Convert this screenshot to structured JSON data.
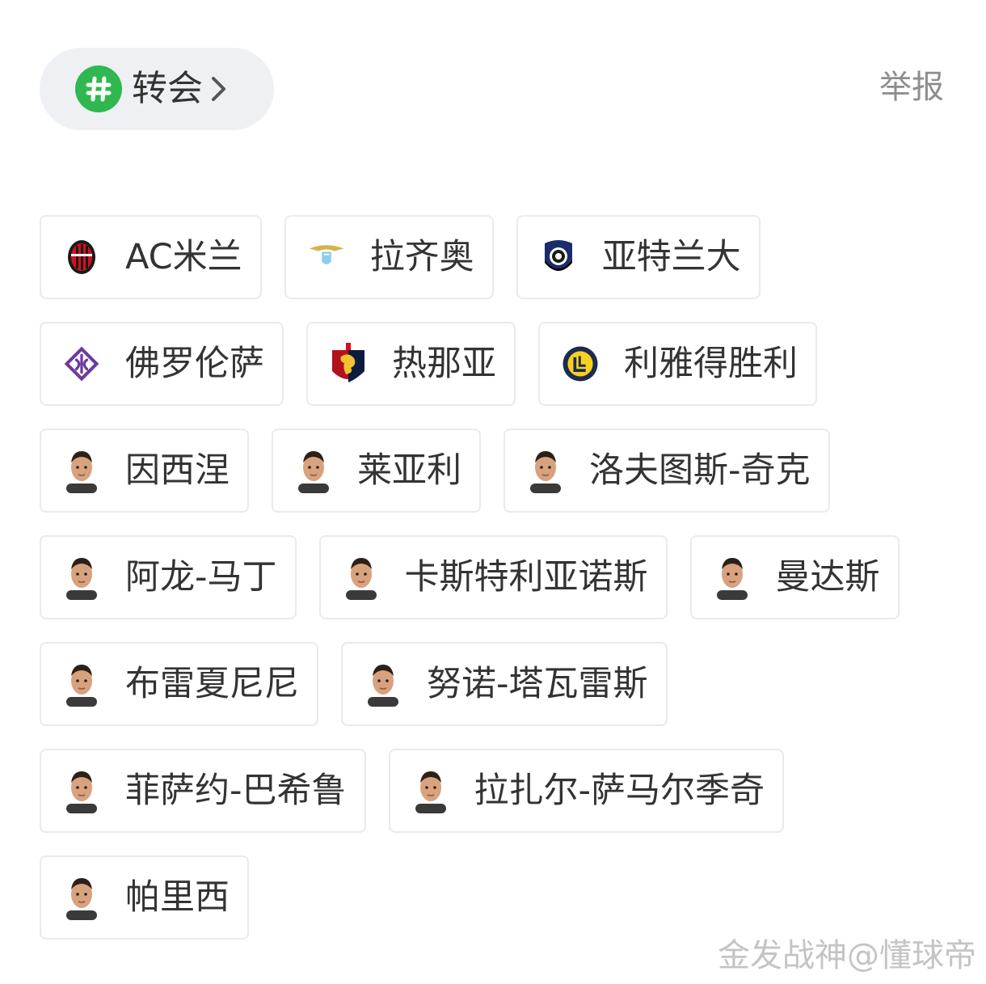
{
  "topic": {
    "label": "转会",
    "icon": "hashtag-icon",
    "accent_color": "#2fb84f"
  },
  "report_label": "举报",
  "tag_rows": [
    [
      {
        "label": "AC米兰",
        "icon": "ac-milan-crest-icon"
      },
      {
        "label": "拉齐奥",
        "icon": "lazio-crest-icon"
      },
      {
        "label": "亚特兰大",
        "icon": "atalanta-crest-icon"
      }
    ],
    [
      {
        "label": "佛罗伦萨",
        "icon": "fiorentina-crest-icon"
      },
      {
        "label": "热那亚",
        "icon": "genoa-crest-icon"
      },
      {
        "label": "利雅得胜利",
        "icon": "al-nassr-crest-icon"
      }
    ],
    [
      {
        "label": "因西涅",
        "icon": "player-avatar-icon"
      },
      {
        "label": "莱亚利",
        "icon": "player-avatar-icon"
      },
      {
        "label": "洛夫图斯-奇克",
        "icon": "player-avatar-icon"
      }
    ],
    [
      {
        "label": "阿龙-马丁",
        "icon": "player-avatar-icon"
      },
      {
        "label": "卡斯特利亚诺斯",
        "icon": "player-avatar-icon"
      },
      {
        "label": "曼达斯",
        "icon": "player-avatar-icon"
      }
    ],
    [
      {
        "label": "布雷夏尼尼",
        "icon": "player-avatar-icon"
      },
      {
        "label": "努诺-塔瓦雷斯",
        "icon": "player-avatar-icon"
      }
    ],
    [
      {
        "label": "菲萨约-巴希鲁",
        "icon": "player-avatar-icon"
      },
      {
        "label": "拉扎尔-萨马尔季奇",
        "icon": "player-avatar-icon"
      }
    ],
    [
      {
        "label": "帕里西",
        "icon": "player-avatar-icon"
      }
    ]
  ],
  "watermark": "金发战神@懂球帝"
}
